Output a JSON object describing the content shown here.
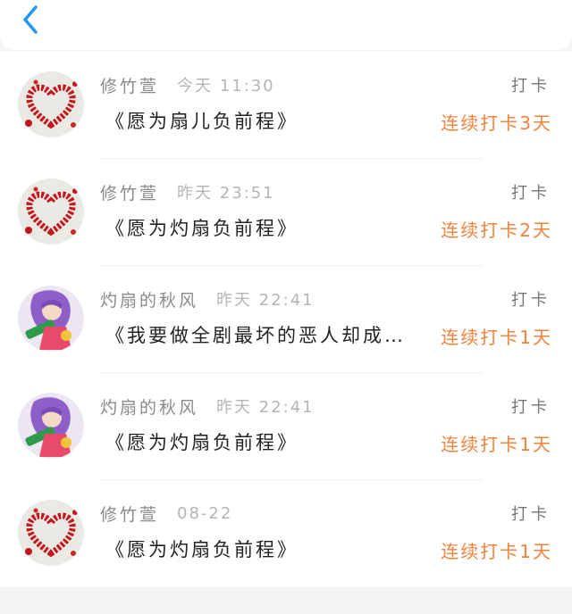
{
  "header": {
    "back_icon": "chevron-left-icon",
    "accent_color": "#2196f3"
  },
  "checkins": [
    {
      "user": "修竹萱",
      "time": "今天 11:30",
      "tag": "打卡",
      "title": "《愿为扇儿负前程》",
      "streak": "连续打卡3天",
      "avatar": "red-heart-avatar"
    },
    {
      "user": "修竹萱",
      "time": "昨天 23:51",
      "tag": "打卡",
      "title": "《愿为灼扇负前程》",
      "streak": "连续打卡2天",
      "avatar": "red-heart-avatar"
    },
    {
      "user": "灼扇的秋风",
      "time": "昨天 22:41",
      "tag": "打卡",
      "title": "《我要做全剧最坏的恶人却成…",
      "streak": "连续打卡1天",
      "avatar": "anime-character-avatar"
    },
    {
      "user": "灼扇的秋风",
      "time": "昨天 22:41",
      "tag": "打卡",
      "title": "《愿为灼扇负前程》",
      "streak": "连续打卡1天",
      "avatar": "anime-character-avatar"
    },
    {
      "user": "修竹萱",
      "time": "08-22",
      "tag": "打卡",
      "title": "《愿为灼扇负前程》",
      "streak": "连续打卡1天",
      "avatar": "red-heart-avatar"
    }
  ],
  "colors": {
    "streak": "#f2823c",
    "name": "#8a8a8a",
    "time": "#b5b5b5",
    "title": "#222222",
    "background": "#f5f5f5"
  }
}
